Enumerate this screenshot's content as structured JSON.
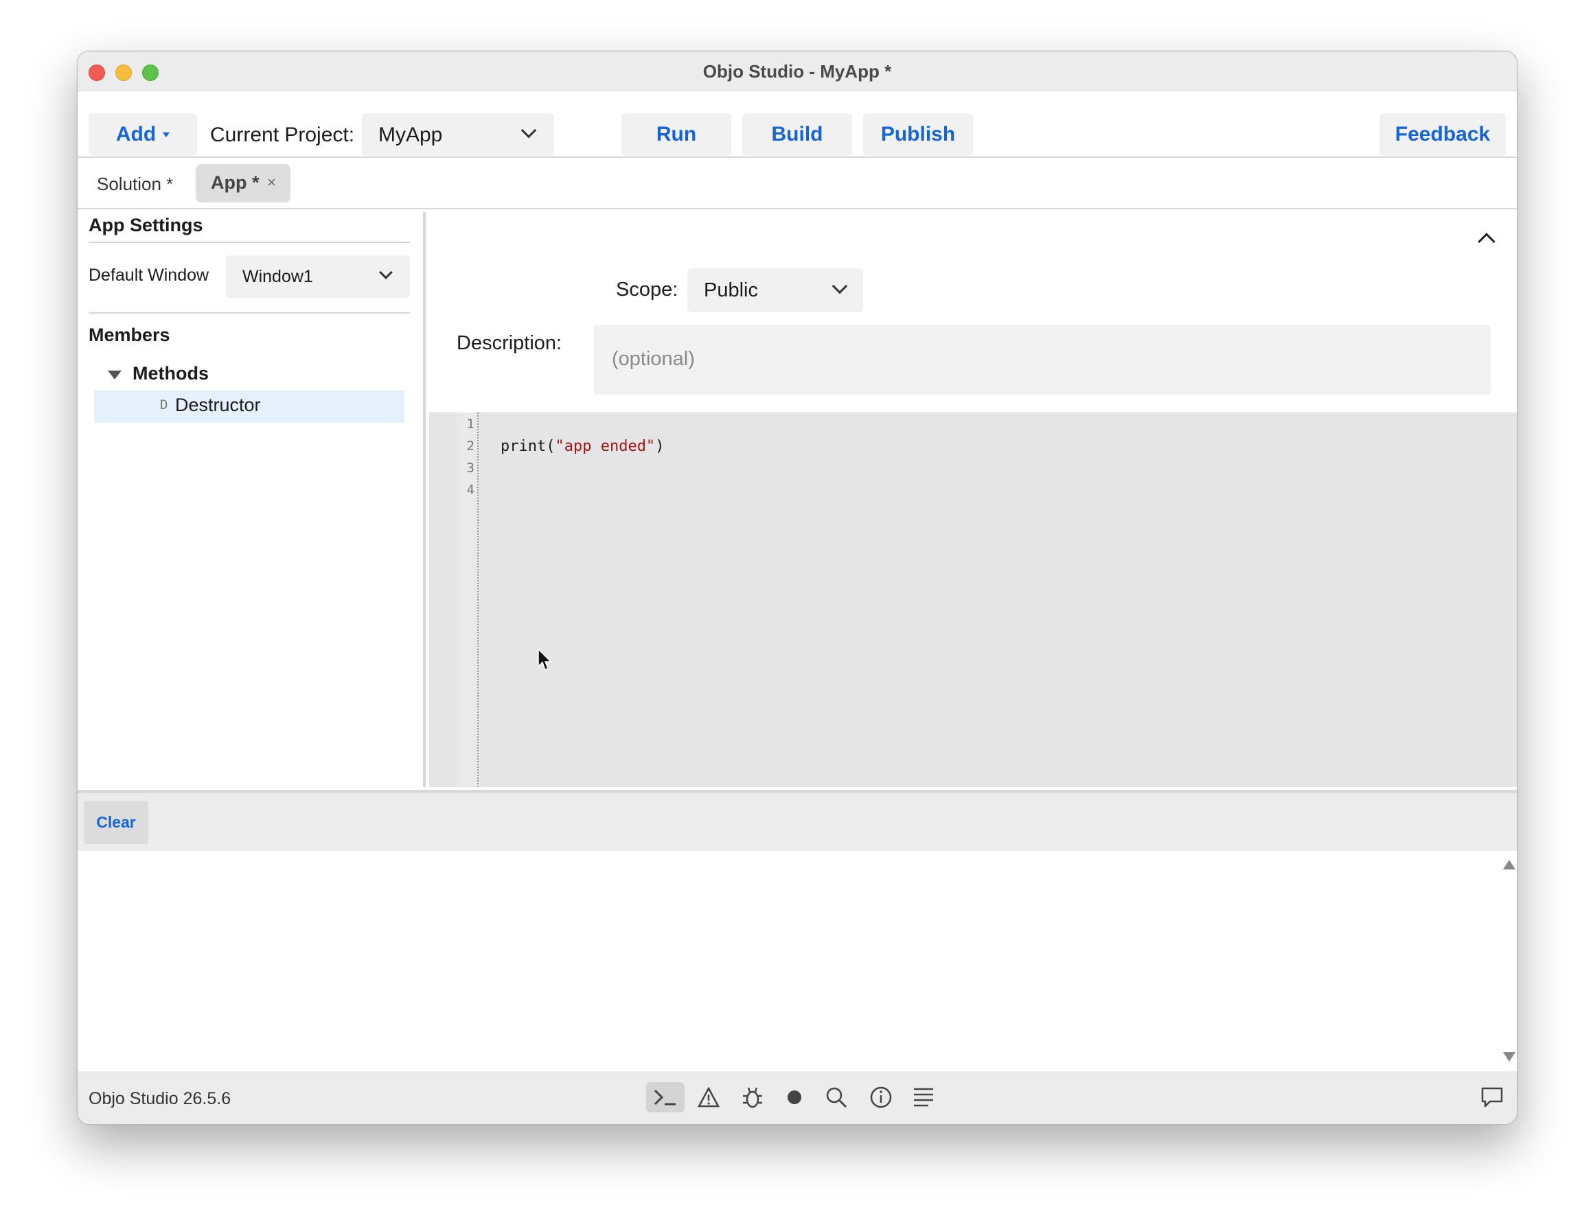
{
  "window": {
    "title": "Objo Studio - MyApp *"
  },
  "toolbar": {
    "add_label": "Add",
    "current_project_label": "Current Project:",
    "current_project_value": "MyApp",
    "run_label": "Run",
    "build_label": "Build",
    "publish_label": "Publish",
    "feedback_label": "Feedback"
  },
  "tabs": {
    "solution_label": "Solution *",
    "app_label": "App *",
    "close_glyph": "×"
  },
  "app_settings": {
    "title": "App Settings",
    "default_window_label": "Default Window",
    "default_window_value": "Window1"
  },
  "members": {
    "title": "Members",
    "group_label": "Methods",
    "items": [
      {
        "badge": "D",
        "label": "Destructor"
      }
    ]
  },
  "method_props": {
    "scope_label": "Scope:",
    "scope_value": "Public",
    "description_label": "Description:",
    "description_placeholder": "(optional)"
  },
  "editor": {
    "line_numbers": [
      "1",
      "2",
      "3",
      "4"
    ],
    "code_fn": "print(",
    "code_str": "\"app ended\"",
    "code_close": ")"
  },
  "console": {
    "clear_label": "Clear"
  },
  "status": {
    "version_text": "Objo Studio 26.5.6",
    "icons": [
      "terminal-icon",
      "warning-icon",
      "bug-icon",
      "breakpoint-icon",
      "search-icon",
      "info-icon",
      "list-icon",
      "chat-icon"
    ]
  },
  "colors": {
    "accent": "#1565d8",
    "string": "#a31515",
    "selection": "#e6f0fc"
  }
}
